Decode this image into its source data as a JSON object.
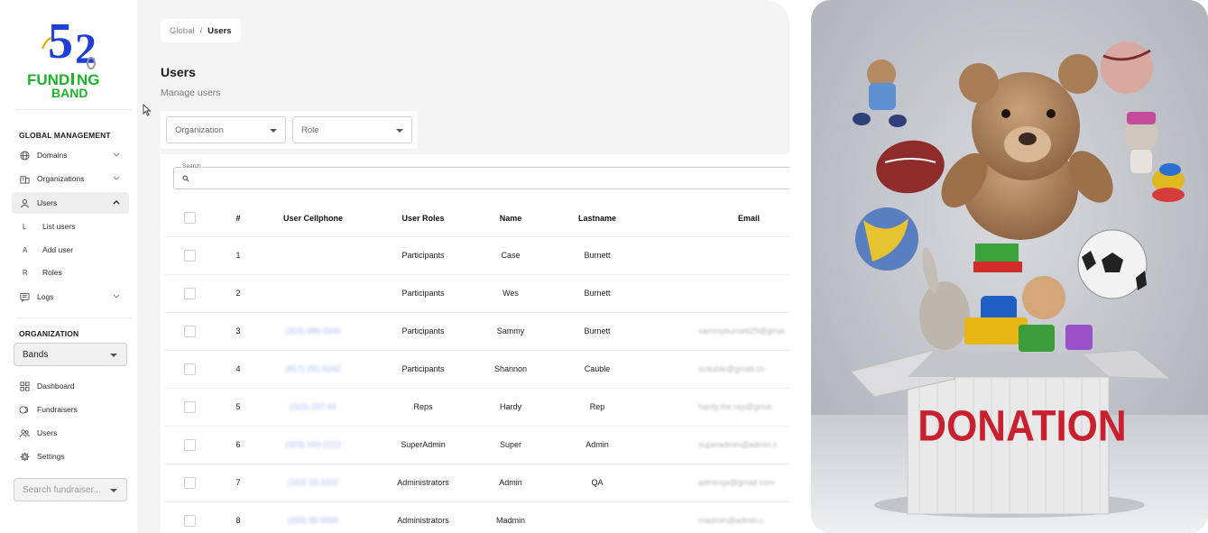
{
  "logo": {
    "num_left": "5",
    "num_right": "2",
    "word1": "FUND",
    "word1b": "NG",
    "word2": "BAND"
  },
  "sidebar": {
    "global_heading": "GLOBAL MANAGEMENT",
    "items": [
      {
        "label": "Domains"
      },
      {
        "label": "Organizations"
      },
      {
        "label": "Users"
      }
    ],
    "sub_items": [
      {
        "key": "L",
        "label": "List users"
      },
      {
        "key": "A",
        "label": "Add user"
      },
      {
        "key": "R",
        "label": "Roles"
      }
    ],
    "logs_label": "Logs",
    "org_heading": "ORGANIZATION",
    "org_select": "Bands",
    "org_items": [
      {
        "label": "Dashboard"
      },
      {
        "label": "Fundraisers"
      },
      {
        "label": "Users"
      },
      {
        "label": "Settings"
      }
    ],
    "search_fundraiser_placeholder": "Search fundraiser..."
  },
  "breadcrumb": {
    "root": "Global",
    "sep": "/",
    "current": "Users"
  },
  "page": {
    "title": "Users",
    "subtitle": "Manage users"
  },
  "filters": {
    "organization": "Organization",
    "role": "Role"
  },
  "search": {
    "label": "Search",
    "placeholder": ""
  },
  "table": {
    "headers": [
      "#",
      "User Cellphone",
      "User Roles",
      "Name",
      "Lastname",
      "Email"
    ],
    "rows": [
      {
        "n": "1",
        "phone": "",
        "role": "Participants",
        "name": "Case",
        "last": "Burnett",
        "email": ""
      },
      {
        "n": "2",
        "phone": "",
        "role": "Participants",
        "name": "Wes",
        "last": "Burnett",
        "email": ""
      },
      {
        "n": "3",
        "phone": "(323) 986-3346",
        "role": "Participants",
        "name": "Sammy",
        "last": "Burnett",
        "email": "sammyburnett29@gmai"
      },
      {
        "n": "4",
        "phone": "(817) 291-5242",
        "role": "Participants",
        "name": "Shannon",
        "last": "Cauble",
        "email": "scauble@gmail.co"
      },
      {
        "n": "5",
        "phone": "(323) 237-44",
        "role": "Reps",
        "name": "Hardy",
        "last": "Rep",
        "email": "hardy.the.rep@gmai"
      },
      {
        "n": "6",
        "phone": "(323) 333-2222",
        "role": "SuperAdmin",
        "name": "Super",
        "last": "Admin",
        "email": "superadmin@admin.c"
      },
      {
        "n": "7",
        "phone": "(333) 33-3332",
        "role": "Administrators",
        "name": "Admin",
        "last": "QA",
        "email": "adminqa@gmail.com"
      },
      {
        "n": "8",
        "phone": "(333) 55-5555",
        "role": "Administrators",
        "name": "Madmin",
        "last": "",
        "email": "madmin@admin.c"
      }
    ]
  },
  "hero": {
    "box_text": "DONATION"
  },
  "colors": {
    "logo_blue": "#1f3fd6",
    "logo_green": "#1fb12b",
    "box_text": "#c8202e"
  }
}
